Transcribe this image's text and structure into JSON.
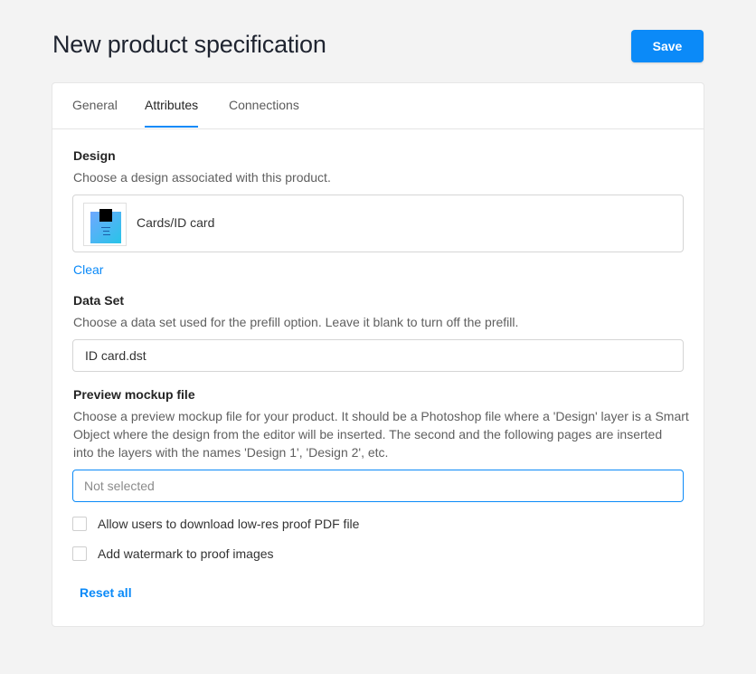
{
  "header": {
    "title": "New product specification",
    "save_label": "Save"
  },
  "tabs": [
    {
      "label": "General",
      "active": false
    },
    {
      "label": "Attributes",
      "active": true
    },
    {
      "label": "Connections",
      "active": false
    }
  ],
  "design": {
    "title": "Design",
    "description": "Choose a design associated with this product.",
    "selected_label": "Cards/ID card",
    "clear_label": "Clear"
  },
  "data_set": {
    "title": "Data Set",
    "description": "Choose a data set used for the prefill option. Leave it blank to turn off the prefill.",
    "value": "ID card.dst"
  },
  "preview": {
    "title": "Preview mockup file",
    "description_lines": [
      "Choose a preview mockup file for your product. It should be a Photoshop file where a 'Design' layer is a Smart",
      "Object where the design from the editor will be inserted. The second and the following pages are inserted",
      "into the layers with the names 'Design 1', 'Design 2', etc."
    ],
    "placeholder": "Not selected"
  },
  "options": [
    {
      "label": "Allow users to download low-res proof PDF file",
      "checked": false
    },
    {
      "label": "Add watermark to proof images",
      "checked": false
    }
  ],
  "reset_label": "Reset all",
  "colors": {
    "accent": "#0b8af8",
    "background": "#f3f3f3"
  }
}
